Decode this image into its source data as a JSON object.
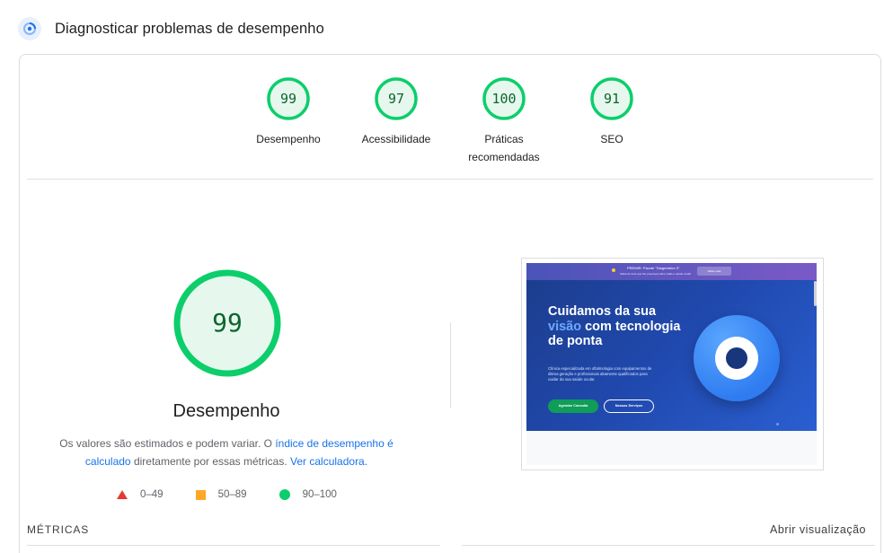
{
  "header": {
    "title": "Diagnosticar problemas de desempenho",
    "icon": "lighthouse-gauge-icon"
  },
  "categories": [
    {
      "label": "Desempenho",
      "score": 99
    },
    {
      "label": "Acessibilidade",
      "score": 97
    },
    {
      "label": "Práticas recomendadas",
      "score": 100
    },
    {
      "label": "SEO",
      "score": 91
    }
  ],
  "performance": {
    "score": 99,
    "title": "Desempenho",
    "desc_part1": "Os valores são estimados e podem variar. O ",
    "desc_link1": "índice de desempenho é calculado",
    "desc_part2": " diretamente por essas métricas. ",
    "desc_link2": "Ver calculadora",
    "desc_part3": "."
  },
  "legend": [
    {
      "shape": "triangle",
      "range": "0–49",
      "color": "#e53935"
    },
    {
      "shape": "square",
      "range": "50–89",
      "color": "#ffa726"
    },
    {
      "shape": "circle",
      "range": "90–100",
      "color": "#0cce6b"
    }
  ],
  "metrics": {
    "label": "MÉTRICAS",
    "open_view": "Abrir visualização"
  },
  "screenshot": {
    "banner_title": "PREMIR: Pacote \"Diagnóstico 3\"",
    "banner_subtitle": "Saiba de tudo que lhe preocupa sobre visão e saúde ocular",
    "banner_button": "Saiba mais",
    "headline_part1": "Cuidamos da sua ",
    "headline_accent": "visão",
    "headline_part2": " com tecnologia de ponta",
    "paragraph": "Clínica especializada em oftalmologia com equipamentos de última geração e profissionais altamente qualificados para cuidar da sua saúde ocular.",
    "button_primary": "Agendar Consulta",
    "button_secondary": "Nossos Serviços"
  },
  "colors": {
    "pass": "#0cce6b",
    "pass_text": "#0d652d",
    "pass_fill": "#e6f8ee",
    "link": "#1a73e8"
  }
}
